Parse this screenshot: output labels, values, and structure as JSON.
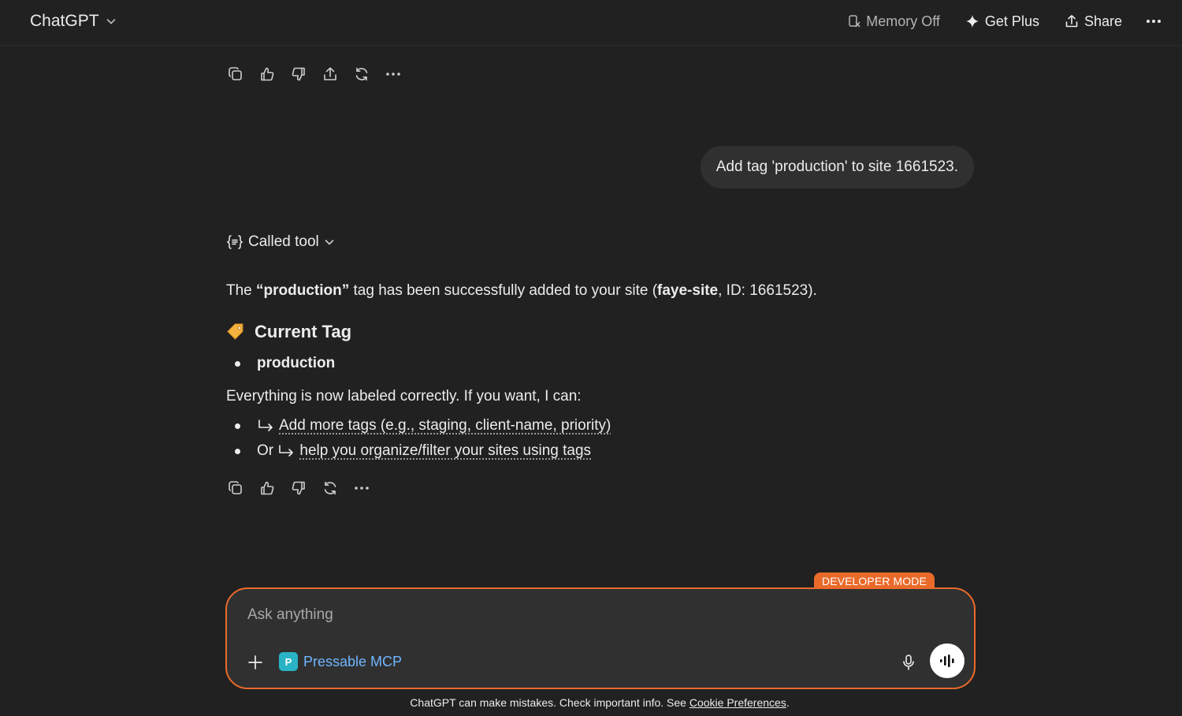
{
  "header": {
    "model_name": "ChatGPT",
    "memory_label": "Memory Off",
    "get_plus_label": "Get Plus",
    "share_label": "Share"
  },
  "conversation": {
    "user_message": "Add tag 'production' to site 1661523.",
    "called_tool_label": "Called tool",
    "response": {
      "intro_pre": "The ",
      "intro_tag": "“production”",
      "intro_mid": " tag has been successfully added to your site (",
      "intro_site": "faye-site",
      "intro_post": ", ID: 1661523).",
      "heading_emoji": "🏷️",
      "heading": "Current Tag",
      "tags": [
        "production"
      ],
      "followup": "Everything is now labeled correctly. If you want, I can:",
      "options": [
        {
          "prefix": "",
          "link": "Add more tags (e.g., staging, client-name, priority)"
        },
        {
          "prefix": "Or ",
          "link": "help you organize/filter your sites using tags"
        }
      ]
    }
  },
  "composer": {
    "badge": "DEVELOPER MODE",
    "placeholder": "Ask anything",
    "tool_chip": "Pressable MCP",
    "tool_logo_letter": "P"
  },
  "footer": {
    "text": "ChatGPT can make mistakes. Check important info. See ",
    "link": "Cookie Preferences",
    "end": "."
  },
  "colors": {
    "background": "#212121",
    "accent": "#ea6a2a",
    "link": "#6fb6ff",
    "mcp_logo": "#29b3c5"
  }
}
